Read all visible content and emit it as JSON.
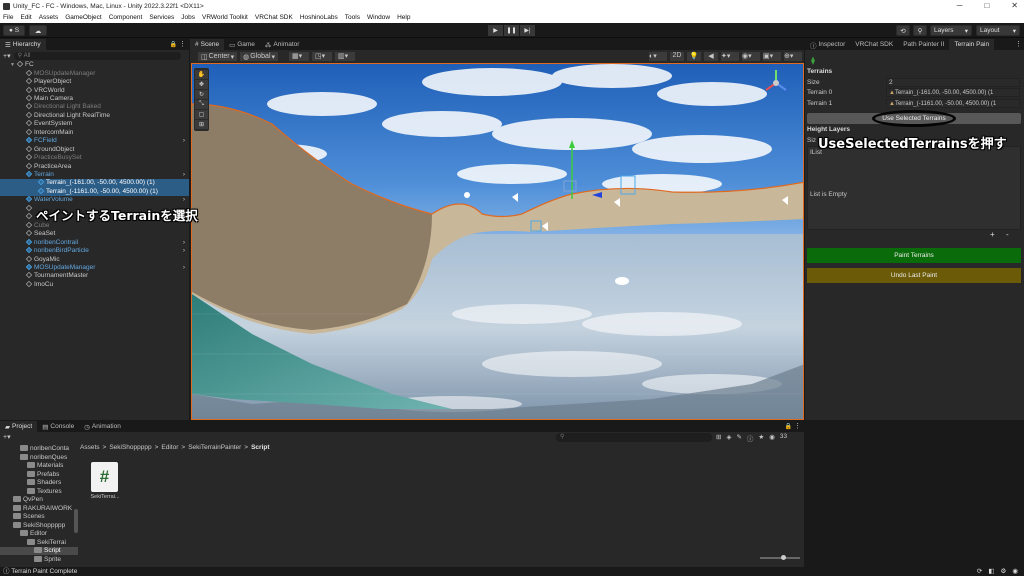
{
  "window": {
    "title": "Unity_FC - FC - Windows, Mac, Linux - Unity 2022.3.22f1 <DX11>"
  },
  "menu": [
    "File",
    "Edit",
    "Assets",
    "GameObject",
    "Component",
    "Services",
    "Jobs",
    "VRWorld Toolkit",
    "VRChat SDK",
    "HoshinoLabs",
    "Tools",
    "Window",
    "Help"
  ],
  "toolbar": {
    "account": "S",
    "layers": "Layers",
    "layout": "Layout"
  },
  "hierarchy": {
    "tab": "Hierarchy",
    "search_placeholder": "All",
    "root": "FC",
    "items": [
      {
        "label": "MOSUpdateManager",
        "style": "dim"
      },
      {
        "label": "PlayerObject",
        "style": "normal"
      },
      {
        "label": "VRCWorld",
        "style": "normal"
      },
      {
        "label": "Main Camera",
        "style": "normal"
      },
      {
        "label": "Directional Light Baked",
        "style": "dim"
      },
      {
        "label": "Directional Light RealTime",
        "style": "normal"
      },
      {
        "label": "EventSystem",
        "style": "normal"
      },
      {
        "label": "IntercomMain",
        "style": "normal"
      },
      {
        "label": "FCField",
        "style": "blue"
      },
      {
        "label": "GroundObject",
        "style": "normal"
      },
      {
        "label": "PracticeBusySet",
        "style": "dim"
      },
      {
        "label": "PracticeArea",
        "style": "normal"
      },
      {
        "label": "Terrain",
        "style": "blue"
      },
      {
        "label": "Terrain_(-161.00, -50.00, 4500.00) (1)",
        "style": "selected"
      },
      {
        "label": "Terrain_(-1161.00, -50.00, 4500.00) (1)",
        "style": "selected"
      },
      {
        "label": "WaterVolume",
        "style": "blue"
      },
      {
        "label": "",
        "style": "dim"
      },
      {
        "label": "",
        "style": "dim"
      },
      {
        "label": "Cube",
        "style": "dim"
      },
      {
        "label": "SeaSet",
        "style": "normal"
      },
      {
        "label": "noribenContrail",
        "style": "blue"
      },
      {
        "label": "noribenBirdParticle",
        "style": "blue"
      },
      {
        "label": "GoyaMic",
        "style": "normal"
      },
      {
        "label": "MOSUpdateManager",
        "style": "blue"
      },
      {
        "label": "TournamentMaster",
        "style": "normal"
      },
      {
        "label": "ImoCu",
        "style": "normal"
      }
    ]
  },
  "scene": {
    "tabs": [
      "Scene",
      "Game",
      "Animator"
    ],
    "pivot": "Center",
    "space": "Global"
  },
  "inspector": {
    "tabs": [
      "Inspector",
      "VRChat SDK",
      "Path Painter II",
      "Terrain Pain"
    ],
    "terrains_header": "Terrains",
    "size_label": "Size",
    "size_value": "2",
    "terrain0_label": "Terrain 0",
    "terrain0_value": "Terrain_(-161.00, -50.00, 4500.00) (1",
    "terrain1_label": "Terrain 1",
    "terrain1_value": "Terrain_(-1161.00, -50.00, 4500.00) (1",
    "use_selected_button": "Use Selected Terrains",
    "height_layers_header": "Height Layers",
    "height_size_label": "Siz",
    "ilist_label": "IList",
    "list_empty": "List is Empty",
    "add_button": "+",
    "remove_button": "-",
    "paint_button": "Paint Terrains",
    "undo_button": "Undo Last Paint",
    "paint_color": "#0a6b0a",
    "undo_color": "#6b5a08"
  },
  "project": {
    "tabs": [
      "Project",
      "Console",
      "Animation"
    ],
    "breadcrumb": [
      "Assets",
      "SekiShoppppp",
      "Editor",
      "SekiTerrainPainter",
      "Script"
    ],
    "tree": [
      {
        "label": "noribenConta",
        "indent": 2
      },
      {
        "label": "noribenQues",
        "indent": 2
      },
      {
        "label": "Materials",
        "indent": 3
      },
      {
        "label": "Prefabs",
        "indent": 3
      },
      {
        "label": "Shaders",
        "indent": 3
      },
      {
        "label": "Textures",
        "indent": 3
      },
      {
        "label": "QvPen",
        "indent": 1
      },
      {
        "label": "RAKURAIWORK",
        "indent": 1
      },
      {
        "label": "Scenes",
        "indent": 1
      },
      {
        "label": "SekiShoppppp",
        "indent": 1
      },
      {
        "label": "Editor",
        "indent": 2
      },
      {
        "label": "SekiTerrai",
        "indent": 3
      },
      {
        "label": "Script",
        "indent": 4
      },
      {
        "label": "Sprite",
        "indent": 4
      }
    ],
    "asset_label": "SekiTerrai...",
    "count": "33"
  },
  "status": {
    "message": "Terrain Paint Complete"
  },
  "annotations": {
    "hierarchy_note": "ペイントするTerrainを選択",
    "inspector_note": "UseSelectedTerrainsを押す"
  }
}
